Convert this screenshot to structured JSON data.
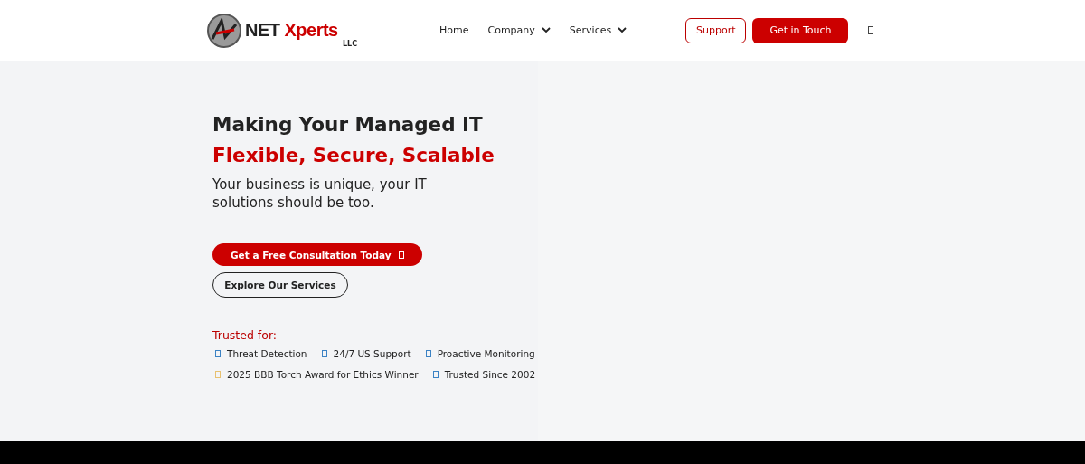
{
  "header": {
    "logo": {
      "word1": "NET",
      "word2": "Xperts",
      "suffix": "LLC"
    },
    "nav": [
      {
        "label": "Home",
        "dropdown": false
      },
      {
        "label": "Company",
        "dropdown": true
      },
      {
        "label": "Services",
        "dropdown": true
      }
    ],
    "support_button": "Support",
    "contact_button": "Get in Touch"
  },
  "hero": {
    "title": "Making Your Managed IT",
    "highlight": "Flexible, Secure, Scalable",
    "subtitle": "Your business is unique, your IT solutions should be too.",
    "primary_button": "Get a Free Consultation Today",
    "secondary_button": "Explore Our Services",
    "trusted_label": "Trusted for:",
    "trusted_rows": [
      [
        {
          "label": "Threat Detection",
          "color": "#3b82c4"
        },
        {
          "label": "24/7 US Support",
          "color": "#3b82c4"
        },
        {
          "label": "Proactive Monitoring",
          "color": "#3b82c4"
        }
      ],
      [
        {
          "label": "2025 BBB Torch Award for Ethics Winner",
          "color": "#e8c170"
        },
        {
          "label": "Trusted Since 2002",
          "color": "#3b82c4"
        }
      ]
    ]
  }
}
